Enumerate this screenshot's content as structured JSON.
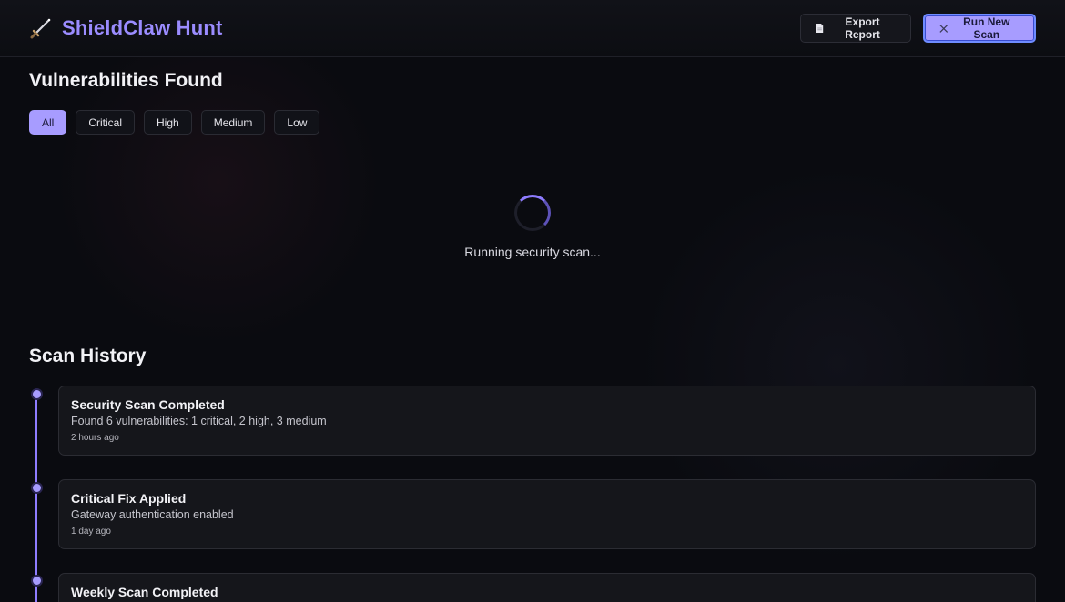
{
  "app": {
    "title": "ShieldClaw Hunt",
    "brand_color": "#9b8cff",
    "icon": "dagger-icon"
  },
  "toolbar": {
    "export_label": "Export Report",
    "export_icon": "document-icon",
    "scan_label": "Run New Scan",
    "scan_icon": "crossed-swords-icon"
  },
  "vulnerabilities": {
    "heading": "Vulnerabilities Found",
    "filters": [
      {
        "label": "All",
        "active": true
      },
      {
        "label": "Critical",
        "active": false
      },
      {
        "label": "High",
        "active": false
      },
      {
        "label": "Medium",
        "active": false
      },
      {
        "label": "Low",
        "active": false
      }
    ],
    "loading_text": "Running security scan..."
  },
  "history": {
    "heading": "Scan History",
    "items": [
      {
        "title": "Security Scan Completed",
        "description": "Found 6 vulnerabilities: 1 critical, 2 high, 3 medium",
        "time": "2 hours ago"
      },
      {
        "title": "Critical Fix Applied",
        "description": "Gateway authentication enabled",
        "time": "1 day ago"
      },
      {
        "title": "Weekly Scan Completed",
        "description": "",
        "time": ""
      }
    ]
  },
  "colors": {
    "accent": "#a79cff",
    "background": "#0a0b10",
    "card": "#15161b"
  }
}
